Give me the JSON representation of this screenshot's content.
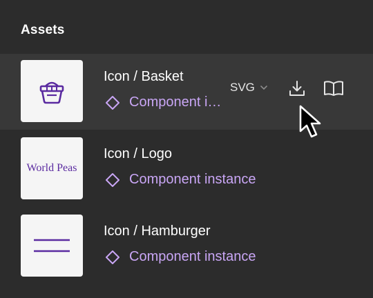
{
  "panel": {
    "title": "Assets"
  },
  "assets": [
    {
      "name": "Icon / Basket",
      "type_label": "Component instance",
      "thumbnail_icon": "basket-icon",
      "hovered": true,
      "format": "SVG"
    },
    {
      "name": "Icon / Logo",
      "type_label": "Component instance",
      "thumbnail_text": "World Peas",
      "hovered": false
    },
    {
      "name": "Icon / Hamburger",
      "type_label": "Component instance",
      "thumbnail_icon": "hamburger-icon",
      "hovered": false
    }
  ],
  "icons": {
    "component": "diamond-icon",
    "format_dropdown": "chevron-down-icon",
    "export": "download-icon",
    "docs": "book-icon",
    "pointer": "mouse-cursor-icon"
  },
  "colors": {
    "panel_bg": "#2c2c2c",
    "row_hover_bg": "#383838",
    "component_purple": "#c9a6f5",
    "brand_purple": "#5a2aa0",
    "text": "#ffffff"
  }
}
